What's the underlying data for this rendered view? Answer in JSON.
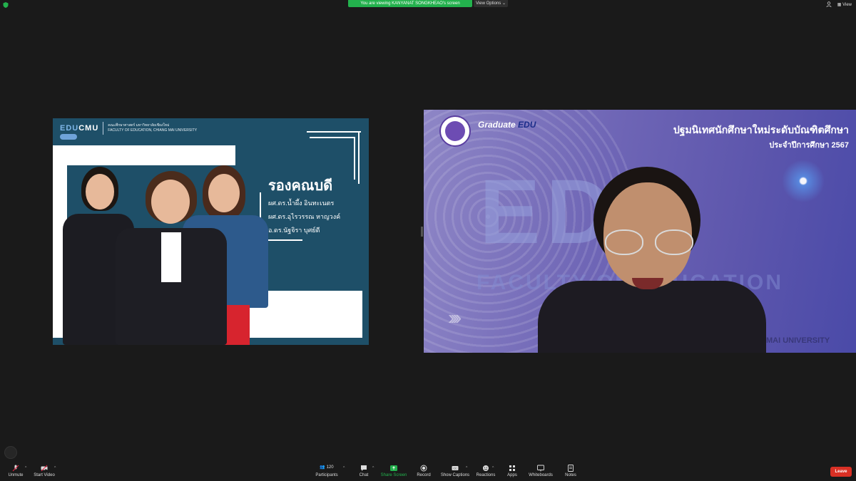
{
  "top": {
    "banner_text": "You are viewing KANYANAT SONGKHEAO's screen",
    "view_options_label": "View Options",
    "view_label": "View"
  },
  "share": {
    "logo_edu": "EDU",
    "logo_cmu": "CMU",
    "logo_line1": "คณะศึกษาศาสตร์ มหาวิทยาลัยเชียงใหม่",
    "logo_line2": "FACULTY OF EDUCATION, CHIANG MAI UNIVERSITY",
    "title": "รองคณบดี",
    "names": [
      "ผศ.ดร.น้ำผึ้ง อินทะเนตร",
      "ผศ.ดร.อุไรวรรณ หาญวงค์",
      "อ.ดร.นัฐจิรา บุศย์ดี"
    ]
  },
  "video": {
    "title": "ปฐมนิเทศนักศึกษาใหม่ระดับบัณฑิตศึกษา",
    "subtitle": "ประจำปีการศึกษา 2567",
    "graduate": "Graduate",
    "edu": "EDU",
    "bg_edu": "EDU",
    "bg_faculty": "FACULTY OF EDUCATION",
    "bg_mai": "MAI UNIVERSITY"
  },
  "toolbar": {
    "unmute": "Unmute",
    "start_video": "Start Video",
    "participants": "Participants",
    "participants_count": "120",
    "chat": "Chat",
    "share_screen": "Share Screen",
    "record": "Record",
    "show_captions": "Show Captions",
    "reactions": "Reactions",
    "apps": "Apps",
    "whiteboards": "Whiteboards",
    "notes": "Notes",
    "leave": "Leave"
  },
  "colors": {
    "banner_green": "#23b14d",
    "leave_red": "#d93025",
    "slide_teal": "#1e4f68"
  }
}
